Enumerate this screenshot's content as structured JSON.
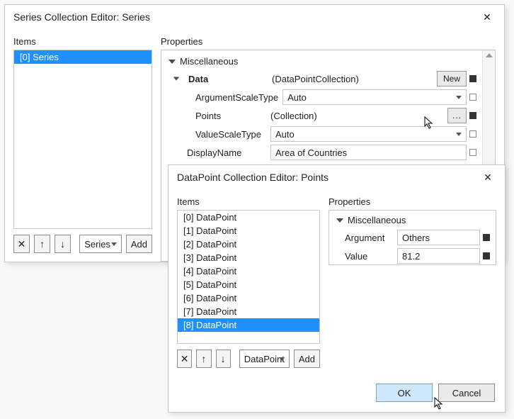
{
  "dialog1": {
    "title": "Series Collection Editor: Series",
    "itemsLabel": "Items",
    "propsLabel": "Properties",
    "items": [
      "[0] Series"
    ],
    "toolbar": {
      "comboLabel": "Series",
      "addLabel": "Add"
    },
    "props": {
      "groupMisc": "Miscellaneous",
      "data": {
        "label": "Data",
        "value": "(DataPointCollection)",
        "newLabel": "New"
      },
      "argScale": {
        "label": "ArgumentScaleType",
        "value": "Auto"
      },
      "points": {
        "label": "Points",
        "value": "(Collection)",
        "btn": "..."
      },
      "valScale": {
        "label": "ValueScaleType",
        "value": "Auto"
      },
      "display": {
        "label": "DisplayName",
        "value": "Area of Countries"
      }
    }
  },
  "dialog2": {
    "title": "DataPoint Collection Editor: Points",
    "itemsLabel": "Items",
    "propsLabel": "Properties",
    "items": [
      "[0] DataPoint",
      "[1] DataPoint",
      "[2] DataPoint",
      "[3] DataPoint",
      "[4] DataPoint",
      "[5] DataPoint",
      "[6] DataPoint",
      "[7] DataPoint",
      "[8] DataPoint"
    ],
    "selectedIndex": 8,
    "toolbar": {
      "comboLabel": "DataPoint",
      "addLabel": "Add"
    },
    "props": {
      "groupMisc": "Miscellaneous",
      "argument": {
        "label": "Argument",
        "value": "Others"
      },
      "value": {
        "label": "Value",
        "value": "81.2"
      }
    },
    "footer": {
      "ok": "OK",
      "cancel": "Cancel"
    }
  }
}
